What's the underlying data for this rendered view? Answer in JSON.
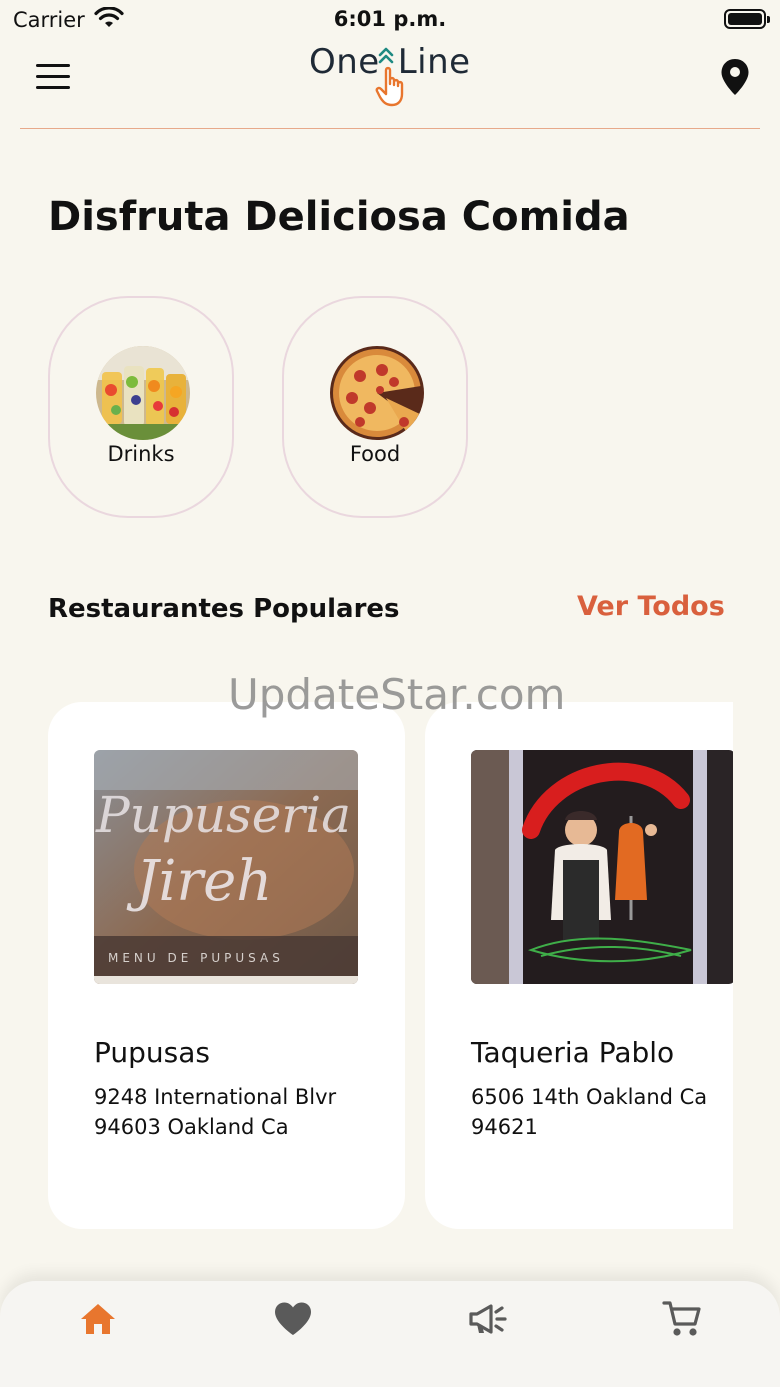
{
  "status_bar": {
    "carrier": "Carrier",
    "time": "6:01 p.m."
  },
  "header": {
    "logo_text_left": "One",
    "logo_text_right": "Line",
    "menu_icon": "hamburger-menu-icon",
    "location_icon": "location-pin-icon"
  },
  "page_title": "Disfruta Deliciosa Comida",
  "categories": [
    {
      "label": "Drinks",
      "image": "drinks-photo"
    },
    {
      "label": "Food",
      "image": "pizza-photo"
    }
  ],
  "popular": {
    "title": "Restaurantes Populares",
    "see_all": "Ver Todos"
  },
  "watermark": "UpdateStar.com",
  "restaurants": [
    {
      "name": "Pupusas",
      "address": "9248 International Blvr 94603 Oakland Ca",
      "photo_sign_script": "Pupuseria",
      "photo_sign_name": "Jireh",
      "photo_banner": "MENU DE PUPUSAS"
    },
    {
      "name": "Taqueria Pablo",
      "address": "6506 14th Oakland Ca 94621"
    }
  ],
  "bottom_nav": [
    {
      "icon": "home-icon",
      "active": true
    },
    {
      "icon": "heart-icon",
      "active": false
    },
    {
      "icon": "megaphone-icon",
      "active": false
    },
    {
      "icon": "cart-icon",
      "active": false
    }
  ],
  "colors": {
    "background": "#f8f6ee",
    "accent": "#d9603d",
    "nav_active": "#e8762e",
    "nav_inactive": "#5a5a5a",
    "tile_border": "#ead7de",
    "header_divider": "#e7a98a",
    "logo_teal": "#1e8a82"
  }
}
